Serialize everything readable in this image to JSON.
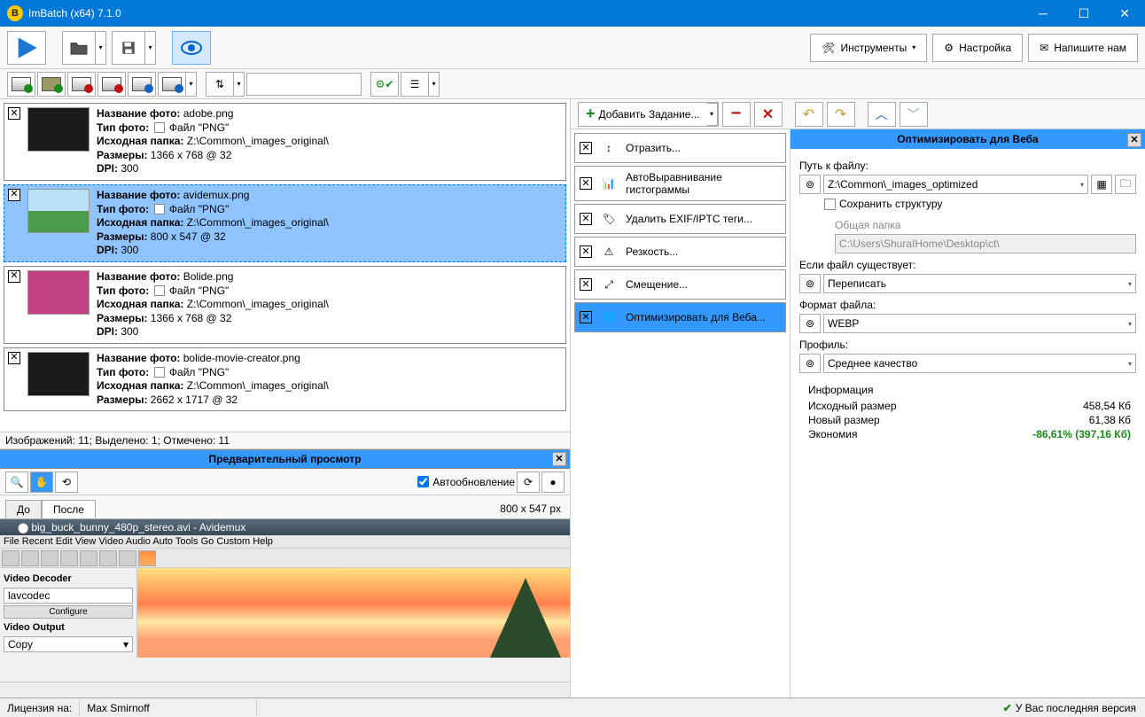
{
  "title": "ImBatch (x64) 7.1.0",
  "header": {
    "tools": "Инструменты",
    "settings": "Настройка",
    "contact": "Напишите нам"
  },
  "addTask": "Добавить Задание...",
  "listStatus": "Изображений: 11; Выделено: 1; Отмечено: 11",
  "images": [
    {
      "name": "adobe.png",
      "type": "Файл \"PNG\"",
      "folder": "Z:\\Common\\_images_original\\",
      "size": "1366 x 768 @ 32",
      "dpi": "300",
      "thumb": "dark"
    },
    {
      "name": "avidemux.png",
      "type": "Файл \"PNG\"",
      "folder": "Z:\\Common\\_images_original\\",
      "size": "800 x 547 @ 32",
      "dpi": "300",
      "thumb": "landscape",
      "selected": true
    },
    {
      "name": "Bolide.png",
      "type": "Файл \"PNG\"",
      "folder": "Z:\\Common\\_images_original\\",
      "size": "1366 x 768 @ 32",
      "dpi": "300",
      "thumb": "video"
    },
    {
      "name": "bolide-movie-creator.png",
      "type": "Файл \"PNG\"",
      "folder": "Z:\\Common\\_images_original\\",
      "size": "2662 x 1717 @ 32",
      "dpi": "",
      "thumb": "dark"
    }
  ],
  "imgLabels": {
    "name": "Название фото:",
    "type": "Тип фото:",
    "folder": "Исходная папка:",
    "size": "Размеры:",
    "dpi": "DPI:"
  },
  "tasks": [
    {
      "label": "Отразить..."
    },
    {
      "label": "АвтоВыравнивание гистограммы"
    },
    {
      "label": "Удалить EXIF/IPTC теги..."
    },
    {
      "label": "Резкость..."
    },
    {
      "label": "Смещение..."
    },
    {
      "label": "Оптимизировать для Веба...",
      "selected": true
    }
  ],
  "props": {
    "title": "Оптимизировать для Веба",
    "pathLabel": "Путь к файлу:",
    "pathValue": "Z:\\Common\\_images_optimized",
    "keepStruct": "Сохранить структуру",
    "commonFolderLabel": "Общая папка",
    "commonFolderValue": "C:\\Users\\ShuraIHome\\Desktop\\ct\\",
    "existsLabel": "Если файл существует:",
    "existsValue": "Переписать",
    "formatLabel": "Формат файла:",
    "formatValue": "WEBP",
    "profileLabel": "Профиль:",
    "profileValue": "Среднее качество",
    "infoLabel": "Информация",
    "origSizeLabel": "Исходный размер",
    "origSizeValue": "458,54 Кб",
    "newSizeLabel": "Новый размер",
    "newSizeValue": "61,38 Кб",
    "saveLabel": "Экономия",
    "saveValue": "-86,61% (397,16 Кб)"
  },
  "preview": {
    "title": "Предварительный просмотр",
    "autoUpdate": "Автообновление",
    "tabBefore": "До",
    "tabAfter": "После",
    "dims": "800 x 547 px",
    "fakeTitle": "big_buck_bunny_480p_stereo.avi - Avidemux",
    "fakeMenu": "File   Recent   Edit   View   Video   Audio   Auto   Tools   Go   Custom   Help",
    "decoder": "Video Decoder",
    "decoderVal": "lavcodec",
    "configure": "Configure",
    "output": "Video Output",
    "outputVal": "Copy"
  },
  "footer": {
    "licenseLabel": "Лицензия на:",
    "licenseValue": "Max Smirnoff",
    "version": "У Вас последняя версия"
  }
}
